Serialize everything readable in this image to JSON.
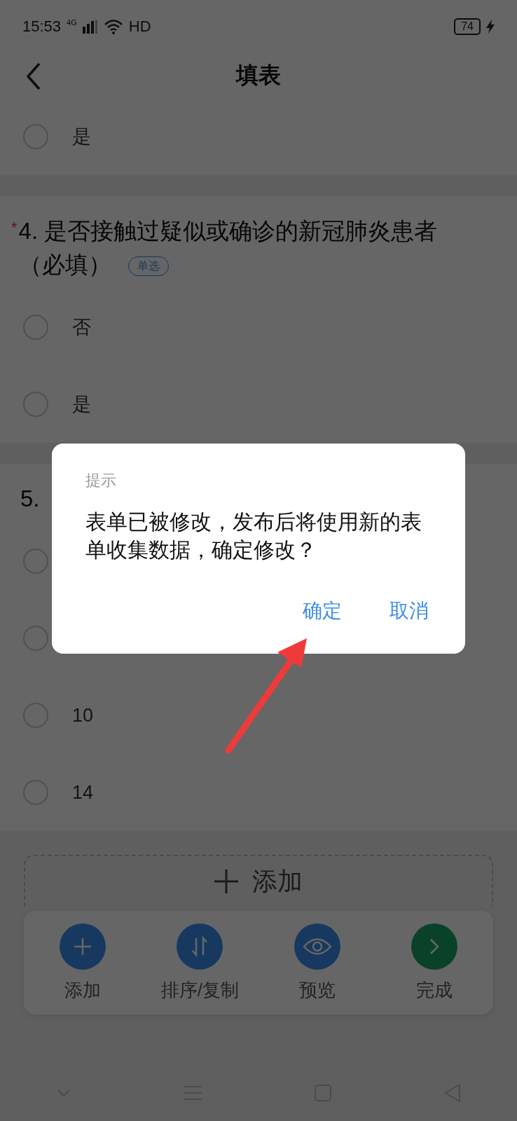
{
  "status_bar": {
    "time": "15:53",
    "network": "4G",
    "wifi_label": "HD",
    "battery": "74"
  },
  "header": {
    "title": "填表"
  },
  "previous_question": {
    "options": [
      {
        "label": "是",
        "selected": false
      }
    ]
  },
  "questions": [
    {
      "number": "4.",
      "title": "是否接触过疑似或确诊的新冠肺炎患者（必填）",
      "required_mark": "*",
      "tag": "单选",
      "options": [
        {
          "label": "否",
          "selected": false
        },
        {
          "label": "是",
          "selected": false
        }
      ]
    },
    {
      "number": "5.",
      "options": [
        {
          "selected": false
        },
        {
          "selected": false
        },
        {
          "label": "10",
          "selected": false
        },
        {
          "label": "14",
          "selected": false
        }
      ]
    }
  ],
  "add_button": {
    "label": "添加"
  },
  "toolbar": [
    {
      "kind": "add",
      "label": "添加"
    },
    {
      "kind": "sort",
      "label": "排序/复制"
    },
    {
      "kind": "preview",
      "label": "预览"
    },
    {
      "kind": "done",
      "label": "完成"
    }
  ],
  "dialog": {
    "title": "提示",
    "message": "表单已被修改，发布后将使用新的表单收集数据，确定修改？",
    "buttons": [
      "确定",
      "取消"
    ]
  }
}
